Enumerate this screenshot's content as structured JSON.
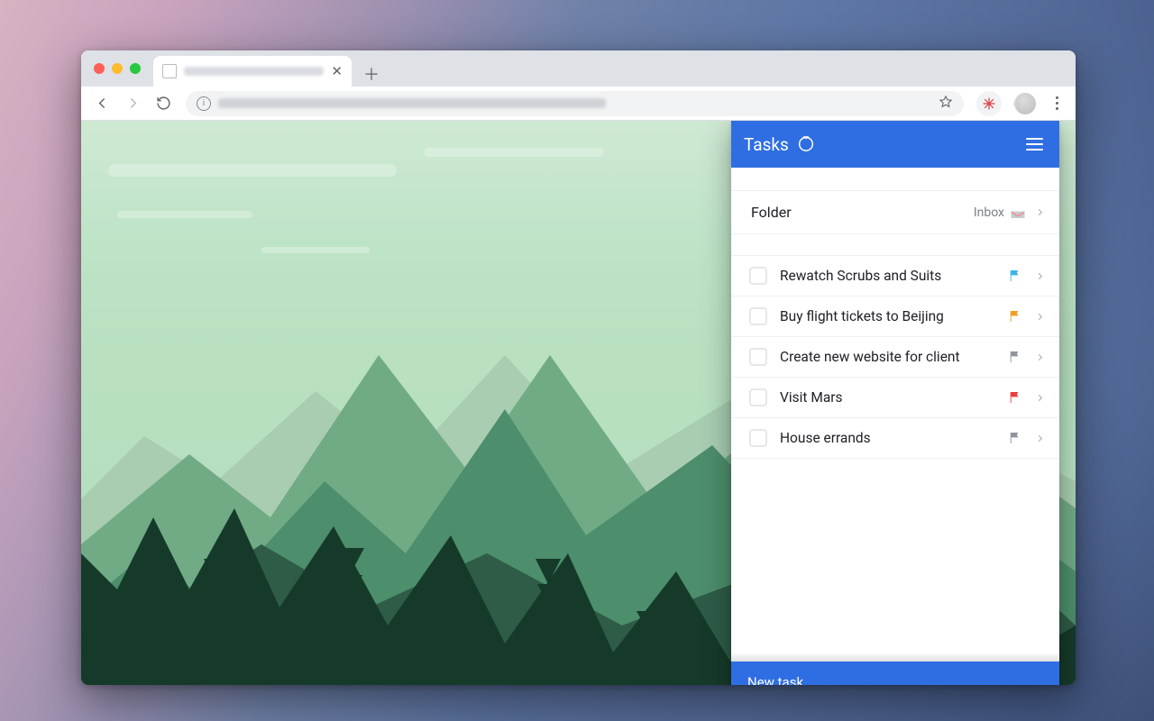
{
  "browser": {
    "tab_title_blurred": true,
    "url_blurred": true,
    "new_tab_tooltip": "New tab"
  },
  "panel": {
    "title": "Tasks",
    "folder": {
      "label": "Folder",
      "value": "Inbox"
    },
    "tasks": [
      {
        "label": "Rewatch Scrubs and Suits",
        "flag_color": "#3eb3e6"
      },
      {
        "label": "Buy flight tickets to Beijing",
        "flag_color": "#ef9f1f"
      },
      {
        "label": "Create new website for client",
        "flag_color": "#8e949b"
      },
      {
        "label": "Visit Mars",
        "flag_color": "#ef3b3b"
      },
      {
        "label": "House errands",
        "flag_color": "#8e949b"
      }
    ],
    "new_task_label": "New task"
  },
  "colors": {
    "accent": "#2f6ee2"
  }
}
